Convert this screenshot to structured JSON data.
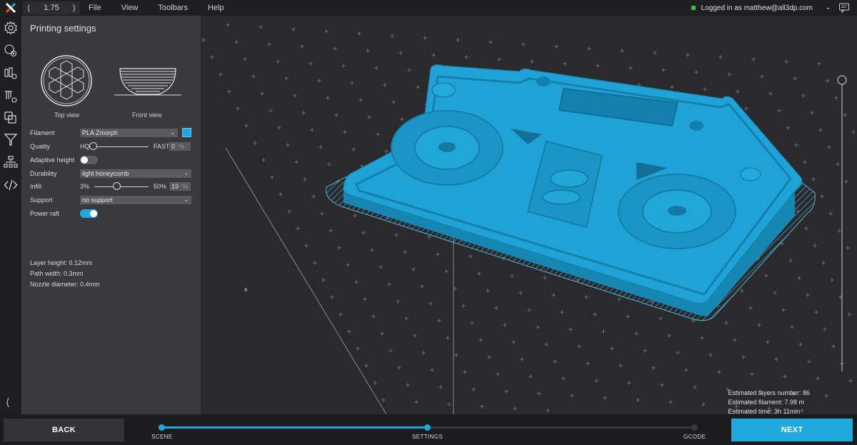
{
  "topbar": {
    "zoom_value": "1.75",
    "menu": [
      "File",
      "View",
      "Toolbars",
      "Help"
    ],
    "login_text": "Logged in as matthew@all3dp.com"
  },
  "panel": {
    "title": "Printing settings",
    "top_view_label": "Top view",
    "front_view_label": "Front view",
    "filament": {
      "label": "Filament",
      "value": "PLA Zmorph",
      "color": "#1fa9dc"
    },
    "quality": {
      "label": "Quality",
      "min_label": "HQ",
      "max_label": "FAST",
      "value": "0",
      "unit": "%"
    },
    "adaptive_height": {
      "label": "Adaptive height",
      "on": false
    },
    "durability": {
      "label": "Durability",
      "value": "light honeycomb"
    },
    "infill": {
      "label": "Infill",
      "min_label": "3%",
      "max_label": "50%",
      "value": "19",
      "unit": "%"
    },
    "support": {
      "label": "Support",
      "value": "no support"
    },
    "power_raft": {
      "label": "Power raft",
      "on": true
    },
    "layer_height": "Layer height: 0.12mm",
    "path_width": "Path width: 0.3mm",
    "nozzle_diameter": "Nozzle diameter: 0.4mm"
  },
  "viewport": {
    "axis_label": "x",
    "estimates": {
      "layers": "Estimated layers number: 86",
      "filament": "Estimated filament: 7.98 m",
      "time": "Estimated time: 3h 11min"
    }
  },
  "footer": {
    "back_label": "BACK",
    "next_label": "NEXT",
    "steps": [
      "SCENE",
      "SETTINGS",
      "GCODE"
    ],
    "accent": "#1fa9dc"
  }
}
